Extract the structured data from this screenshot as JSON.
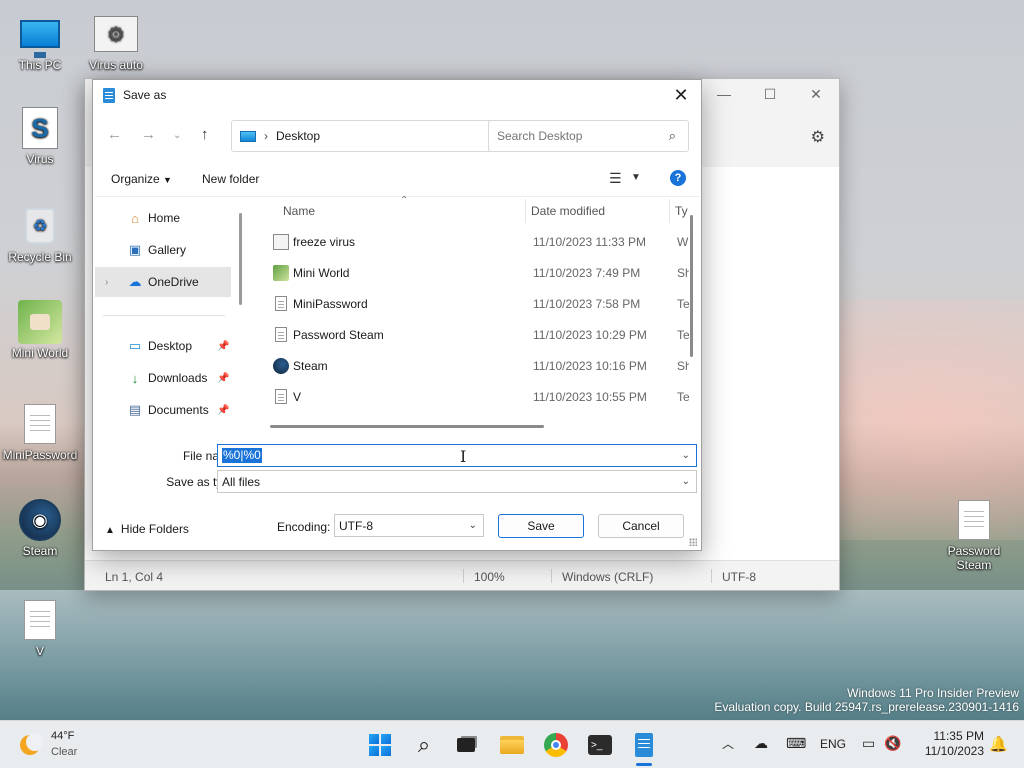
{
  "desktop": {
    "icons": [
      {
        "label": "This PC"
      },
      {
        "label": "Virus auto"
      },
      {
        "label": "Virus"
      },
      {
        "label": "Recycle Bin"
      },
      {
        "label": "Mini World"
      },
      {
        "label": "MiniPassword"
      },
      {
        "label": "Steam"
      },
      {
        "label": "V"
      },
      {
        "label": "Password Steam"
      }
    ]
  },
  "notepad": {
    "status": {
      "position": "Ln 1, Col 4",
      "zoom": "100%",
      "line_ending": "Windows (CRLF)",
      "encoding": "UTF-8"
    }
  },
  "dialog": {
    "title": "Save as",
    "address": {
      "location": "Desktop"
    },
    "search": {
      "placeholder": "Search Desktop"
    },
    "toolbar": {
      "organize": "Organize",
      "new_folder": "New folder",
      "help": "?"
    },
    "nav": [
      {
        "label": "Home",
        "icon": "home-icon"
      },
      {
        "label": "Gallery",
        "icon": "gallery-icon"
      },
      {
        "label": "OneDrive",
        "icon": "cloud-icon"
      },
      {
        "label": "Desktop",
        "icon": "desktop-icon"
      },
      {
        "label": "Downloads",
        "icon": "download-icon"
      },
      {
        "label": "Documents",
        "icon": "documents-icon"
      }
    ],
    "columns": {
      "name": "Name",
      "date": "Date modified",
      "type": "Ty"
    },
    "files": [
      {
        "name": "freeze virus",
        "date": "11/10/2023 11:33 PM",
        "type": "W"
      },
      {
        "name": "Mini World",
        "date": "11/10/2023 7:49 PM",
        "type": "Sh"
      },
      {
        "name": "MiniPassword",
        "date": "11/10/2023 7:58 PM",
        "type": "Te"
      },
      {
        "name": "Password Steam",
        "date": "11/10/2023 10:29 PM",
        "type": "Te"
      },
      {
        "name": "Steam",
        "date": "11/10/2023 10:16 PM",
        "type": "Sh"
      },
      {
        "name": "V",
        "date": "11/10/2023 10:55 PM",
        "type": "Te"
      }
    ],
    "file_name": {
      "label": "File name:",
      "value": "%0|%0"
    },
    "save_type": {
      "label": "Save as type:",
      "value": "All files"
    },
    "hide_folders": "Hide Folders",
    "encoding": {
      "label": "Encoding:",
      "value": "UTF-8"
    },
    "save_label": "Save",
    "cancel_label": "Cancel"
  },
  "watermark": {
    "line1": "Windows 11 Pro Insider Preview",
    "line2": "Evaluation copy. Build 25947.rs_prerelease.230901-1416"
  },
  "taskbar": {
    "weather": {
      "temp": "44°F",
      "condition": "Clear"
    },
    "language": "ENG",
    "time": "11:35 PM",
    "date": "11/10/2023"
  }
}
